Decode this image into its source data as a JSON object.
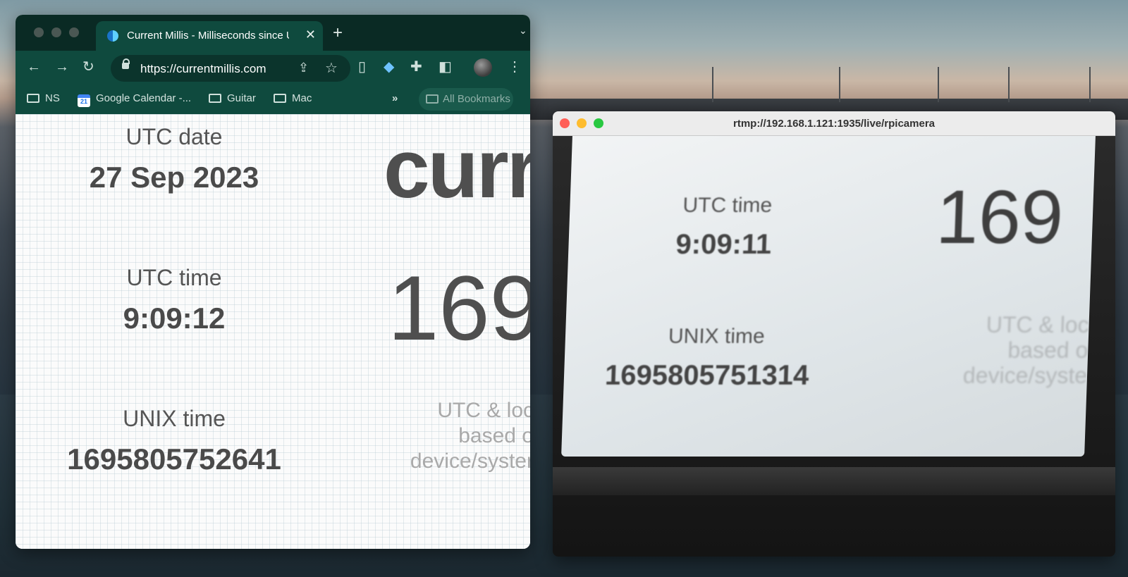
{
  "browser": {
    "tab": {
      "title": "Current Millis - Milliseconds since Unix Epoch",
      "close": "✕"
    },
    "new_tab": "+",
    "tab_menu": "⌄",
    "url": "https://currentmillis.com",
    "bookmarks": [
      {
        "label": "NS",
        "icon": "folder-icon"
      },
      {
        "label": "Google Calendar -...",
        "icon": "calendar-icon",
        "badge": "21"
      },
      {
        "label": "Guitar",
        "icon": "folder-icon"
      },
      {
        "label": "Mac",
        "icon": "folder-icon"
      }
    ],
    "bookmarks_overflow": "»",
    "all_bookmarks": "All Bookmarks"
  },
  "page": {
    "utc_date_label": "UTC date",
    "utc_date_value": "27 Sep 2023",
    "utc_time_label": "UTC time",
    "utc_time_value": "9:09:12",
    "unix_label": "UNIX time",
    "unix_value": "1695805752641",
    "heading_partial": "curr",
    "millis_partial": "169",
    "note_lines": [
      "UTC & loc",
      "based o",
      "device/syster"
    ]
  },
  "video": {
    "title": "rtmp://192.168.1.121:1935/live/rpicamera",
    "utc_time_label": "UTC time",
    "utc_time_value": "9:09:11",
    "unix_label": "UNIX time",
    "unix_value": "1695805751314",
    "millis_partial": "169",
    "note_lines": [
      "UTC & loc",
      "based o",
      "device/syste"
    ]
  },
  "colors": {
    "chrome_frame": "#0a2a24",
    "chrome_toolbar": "#0f4a3e",
    "close": "#ff5f57",
    "minimize": "#febc2e",
    "zoom": "#28c840"
  }
}
